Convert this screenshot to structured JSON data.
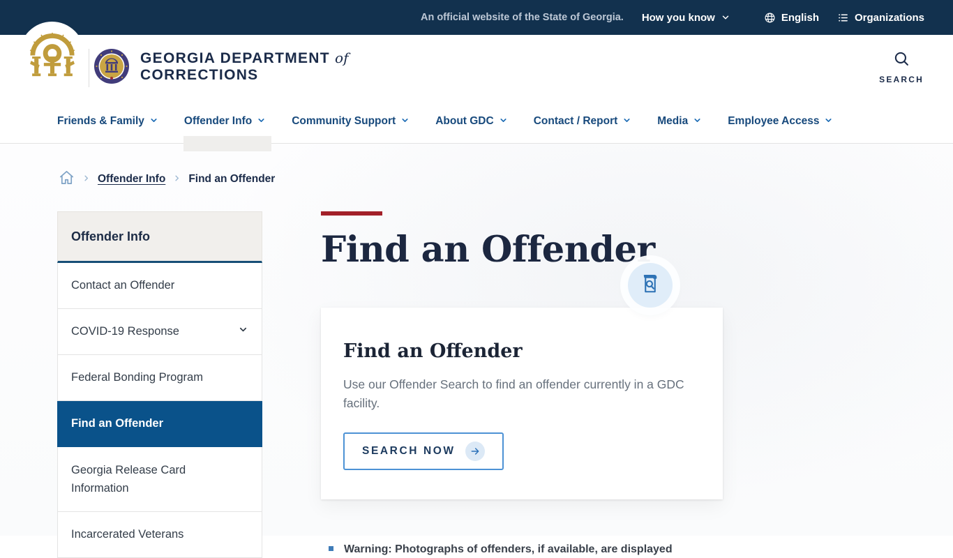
{
  "topbar": {
    "official_text": "An official website of the State of Georgia.",
    "how_you_know": "How you know",
    "language": "English",
    "organizations": "Organizations"
  },
  "header": {
    "agency_name_line1": "GEORGIA DEPARTMENT",
    "agency_name_connector": "of",
    "agency_name_line2": "CORRECTIONS",
    "search_label": "SEARCH"
  },
  "nav": {
    "items": [
      {
        "label": "Friends & Family"
      },
      {
        "label": "Offender Info"
      },
      {
        "label": "Community Support"
      },
      {
        "label": "About GDC"
      },
      {
        "label": "Contact / Report"
      },
      {
        "label": "Media"
      },
      {
        "label": "Employee Access"
      }
    ]
  },
  "breadcrumb": {
    "link": "Offender Info",
    "current": "Find an Offender"
  },
  "sidebar": {
    "title": "Offender Info",
    "items": [
      {
        "label": "Contact an Offender"
      },
      {
        "label": "COVID-19 Response"
      },
      {
        "label": "Federal Bonding Program"
      },
      {
        "label": "Find an Offender"
      },
      {
        "label": "Georgia Release Card Information"
      },
      {
        "label": "Incarcerated Veterans"
      }
    ]
  },
  "main": {
    "title": "Find an Offender",
    "card": {
      "title": "Find an Offender",
      "body": "Use our Offender Search to find an offender currently in a GDC facility.",
      "button_label": "SEARCH NOW"
    },
    "warning": "Warning: Photographs of offenders, if available, are displayed"
  },
  "colors": {
    "topbar_navy": "#12314e",
    "accent_red": "#a32029",
    "active_blue": "#0a528a",
    "nav_blue": "#17497c",
    "button_border_blue": "#4d92d5",
    "icon_blue": "#2d72b5",
    "badge_bg": "#e0edf9",
    "gold": "#c09c3c"
  }
}
